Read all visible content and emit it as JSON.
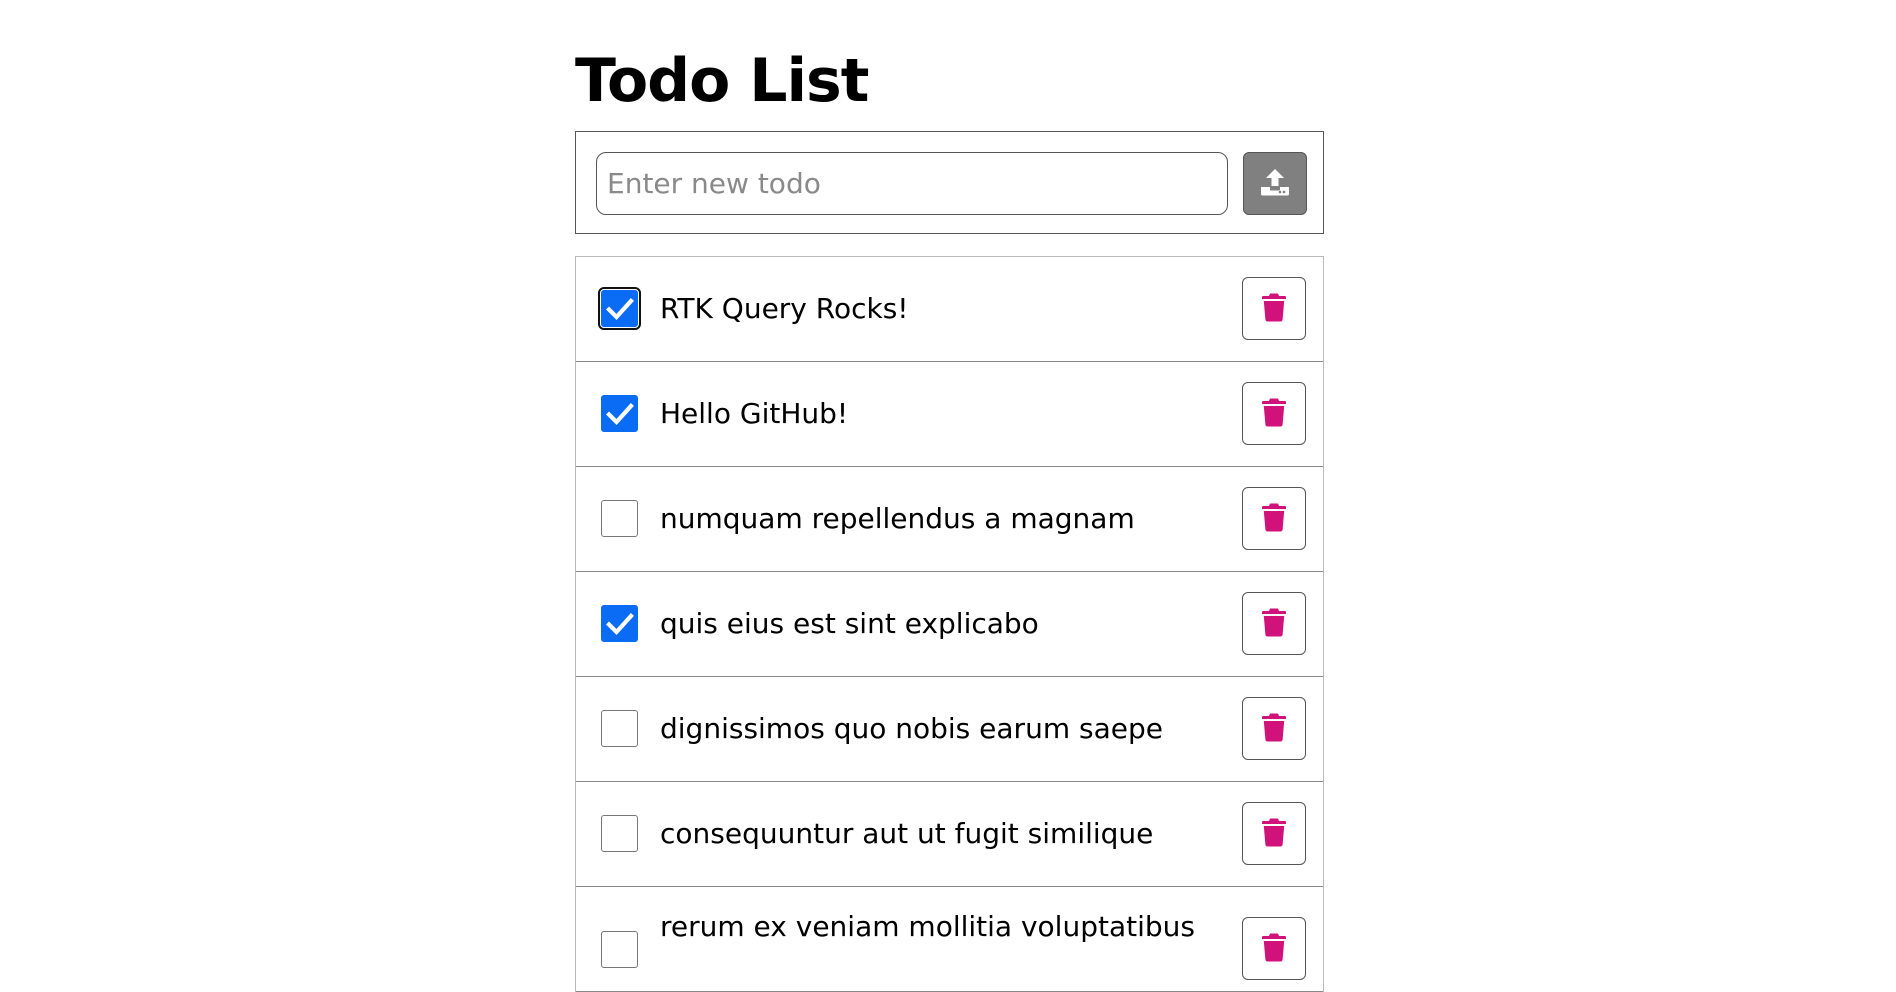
{
  "page": {
    "title": "Todo List"
  },
  "add_form": {
    "placeholder": "Enter new todo",
    "value": "",
    "submit_icon": "upload-icon"
  },
  "colors": {
    "checkbox_checked": "#0a6cf4",
    "delete_icon": "#d1127a",
    "submit_button": "#808080"
  },
  "todos": [
    {
      "text": "RTK Query Rocks!",
      "completed": true,
      "focused": true
    },
    {
      "text": "Hello GitHub!",
      "completed": true,
      "focused": false
    },
    {
      "text": "numquam repellendus a magnam",
      "completed": false,
      "focused": false
    },
    {
      "text": "quis eius est sint explicabo",
      "completed": true,
      "focused": false
    },
    {
      "text": "dignissimos quo nobis earum saepe",
      "completed": false,
      "focused": false
    },
    {
      "text": "consequuntur aut ut fugit similique",
      "completed": false,
      "focused": false
    },
    {
      "text": "rerum ex veniam mollitia voluptatibus",
      "completed": false,
      "focused": false
    }
  ]
}
